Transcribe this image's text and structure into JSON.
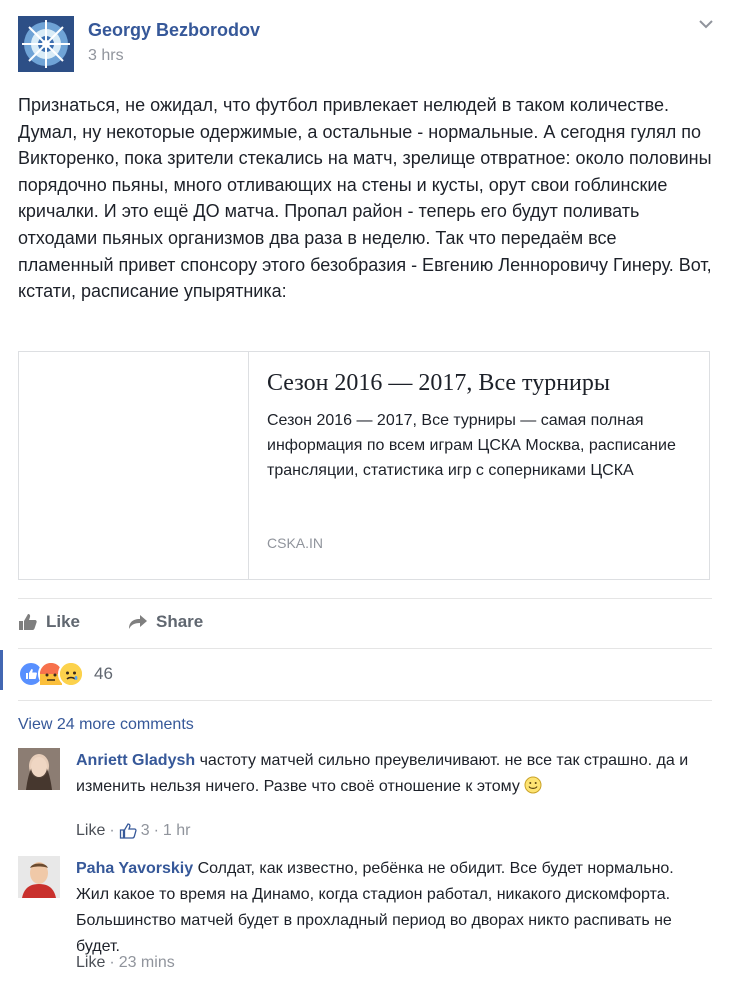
{
  "post": {
    "author": "Georgy Bezborodov",
    "time": "3 hrs",
    "text": "Признаться, не ожидал, что футбол привлекает нелюдей в таком количестве. Думал, ну некоторые одержимые, а остальные - нормальные. А сегодня гулял по Викторенко, пока зрители стекались на матч, зрелище отвратное: около половины порядочно пьяны, много отливающих на стены и кусты, орут свои гоблинские кричалки. И это ещё ДО матча. Пропал район - теперь его будут поливать отходами пьяных организмов два раза в неделю. Так что передаём все пламенный привет спонсору этого безобразия - Евгению Ленноровичу Гинеру. Вот, кстати, расписание упырятника:",
    "link": {
      "title": "Сезон 2016 — 2017, Все турниры",
      "description": "Сезон 2016 — 2017, Все турниры — самая полная информация по всем играм ЦСКА Москва, расписание трансляции, статистика игр с соперниками ЦСКА",
      "domain": "CSKA.IN"
    },
    "actions": {
      "like": "Like",
      "share": "Share"
    },
    "reactions": {
      "count": "46",
      "types": [
        "like-icon",
        "angry-icon",
        "sad-icon"
      ]
    }
  },
  "comments": {
    "view_more": "View 24 more comments",
    "items": [
      {
        "name": "Anriett Gladysh",
        "text": "частоту матчей сильно преувеличивают. не все так страшно. да и изменить нельзя ничего. Разве что своё отношение к этому",
        "like": "Like",
        "likes_count": "3",
        "time": "1 hr"
      },
      {
        "name": "Paha Yavorskiy",
        "text": "Солдат, как известно, ребёнка не обидит. Все будет нормально. Жил какое то время на Динамо, когда стадион работал, никакого дискомфорта. Большинство матчей будет в прохладный период во дворах никто распивать не будет.",
        "like": "Like",
        "time": "23 mins"
      }
    ]
  },
  "colors": {
    "link_blue": "#365899",
    "accent": "#4267b2",
    "meta_gray": "#90949c"
  }
}
